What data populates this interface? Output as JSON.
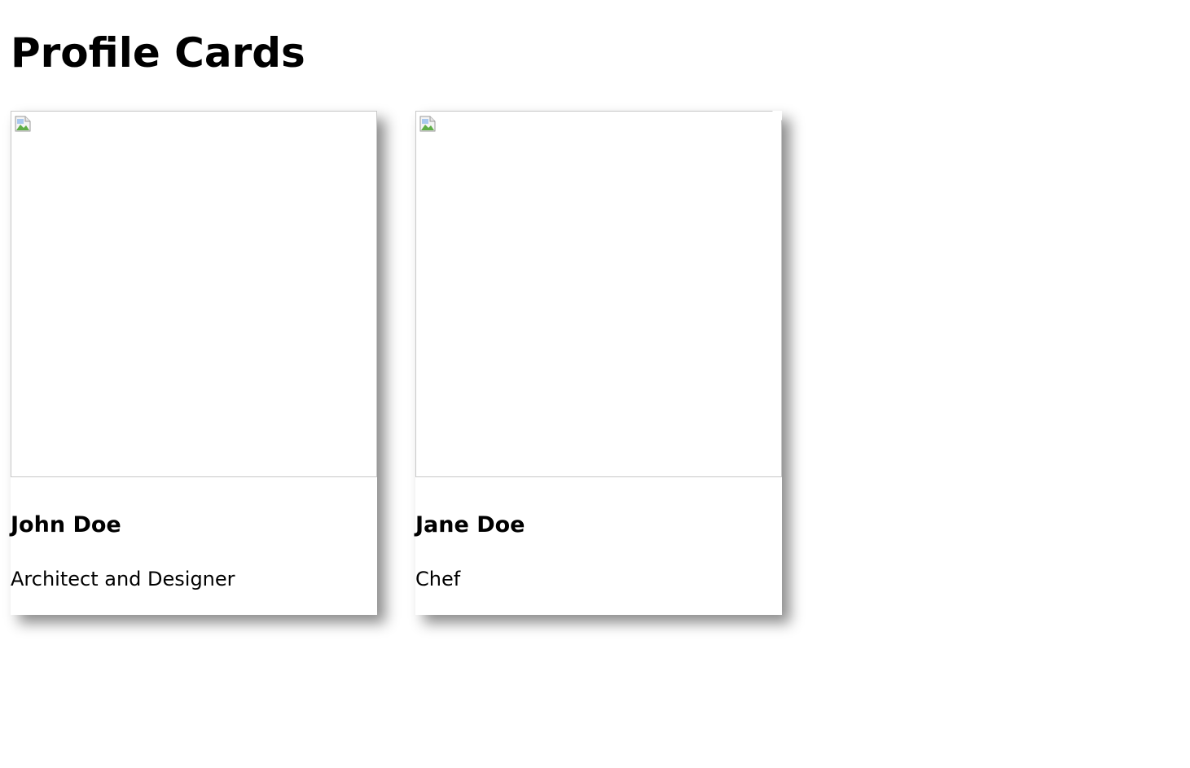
{
  "page": {
    "title": "Profile Cards"
  },
  "cards": [
    {
      "name": "John Doe",
      "role": "Architect and Designer",
      "image_icon": "broken-image-icon"
    },
    {
      "name": "Jane Doe",
      "role": "Chef",
      "image_icon": "broken-image-icon"
    }
  ],
  "colors": {
    "background": "#ffffff",
    "text": "#000000",
    "image_border": "#c8c8c8"
  }
}
